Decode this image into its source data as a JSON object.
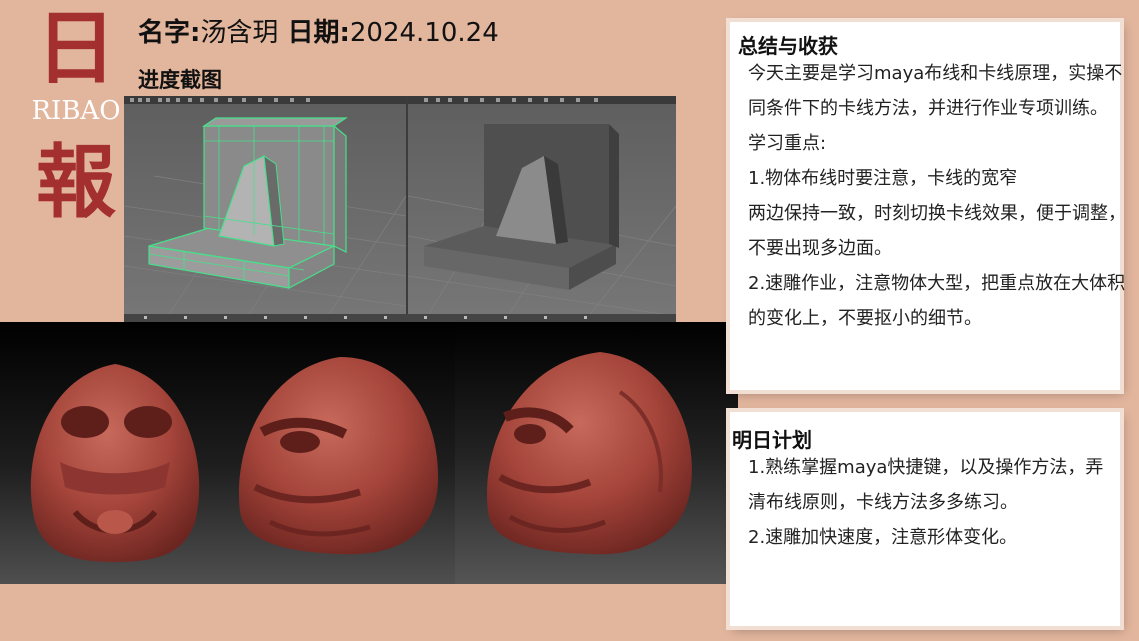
{
  "logo": {
    "char1": "日",
    "latin": "RIBAO",
    "char2": "報"
  },
  "header": {
    "name_label": "名字:",
    "name_value": "汤含玥",
    "date_label": "日期:",
    "date_value": "2024.10.24"
  },
  "progress_label": "进度截图",
  "summary": {
    "title": "总结与收获",
    "lines": [
      "今天主要是学习maya布线和卡线原理，实操不同条件下的卡线方法，并进行作业专项训练。",
      "学习重点:",
      "1.物体布线时要注意，卡线的宽窄",
      "两边保持一致，时刻切换卡线效果，便于调整，不要出现多边面。",
      "2.速雕作业，注意物体大型，把重点放在大体积的变化上，不要抠小的细节。"
    ]
  },
  "plan": {
    "title": "明日计划",
    "lines": [
      "1.熟练掌握maya快捷键，以及操作方法，弄清布线原则，卡线方法多多练习。",
      "2.速雕加快速度，注意形体变化。"
    ]
  },
  "colors": {
    "background": "#E2B59D",
    "logo_red": "#A3302E",
    "wire_green": "#47E08A",
    "sculpt_red": "#A4443A"
  }
}
